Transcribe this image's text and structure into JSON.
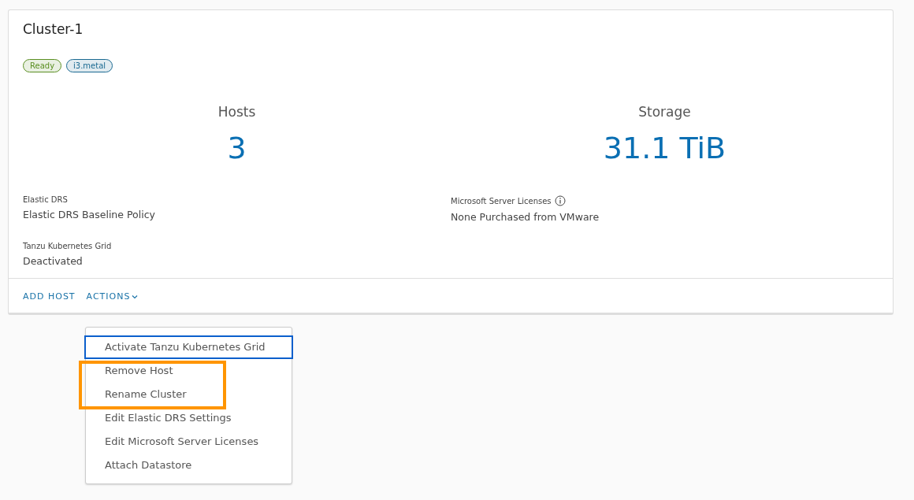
{
  "card": {
    "title": "Cluster-1",
    "tags": [
      {
        "label": "Ready",
        "color": "#5b8f22"
      },
      {
        "label": "i3.metal",
        "color": "#1b6a92"
      }
    ],
    "stats": [
      {
        "label": "Hosts",
        "value": "3"
      },
      {
        "label": "Storage",
        "value": "31.1 TiB"
      }
    ],
    "details": [
      {
        "label": "Elastic DRS",
        "value": "Elastic DRS Baseline Policy",
        "info": false
      },
      {
        "label": "Microsoft Server Licenses",
        "value": "None Purchased from VMware",
        "info": true
      },
      {
        "label": "Tanzu Kubernetes Grid",
        "value": "Deactivated",
        "info": false
      }
    ],
    "footer_actions": [
      {
        "label": "ADD HOST",
        "kind": "button"
      },
      {
        "label": "ACTIONS",
        "kind": "dropdown",
        "expanded": true
      }
    ]
  },
  "actions_menu": {
    "items": [
      {
        "label": "Activate Tanzu Kubernetes Grid",
        "focused": true,
        "highlighted": false
      },
      {
        "label": "Remove Host",
        "focused": false,
        "highlighted": true
      },
      {
        "label": "Rename Cluster",
        "focused": false,
        "highlighted": true
      },
      {
        "label": "Edit Elastic DRS Settings",
        "focused": false,
        "highlighted": false
      },
      {
        "label": "Edit Microsoft Server Licenses",
        "focused": false,
        "highlighted": false
      },
      {
        "label": "Attach Datastore",
        "focused": false,
        "highlighted": false
      }
    ]
  }
}
